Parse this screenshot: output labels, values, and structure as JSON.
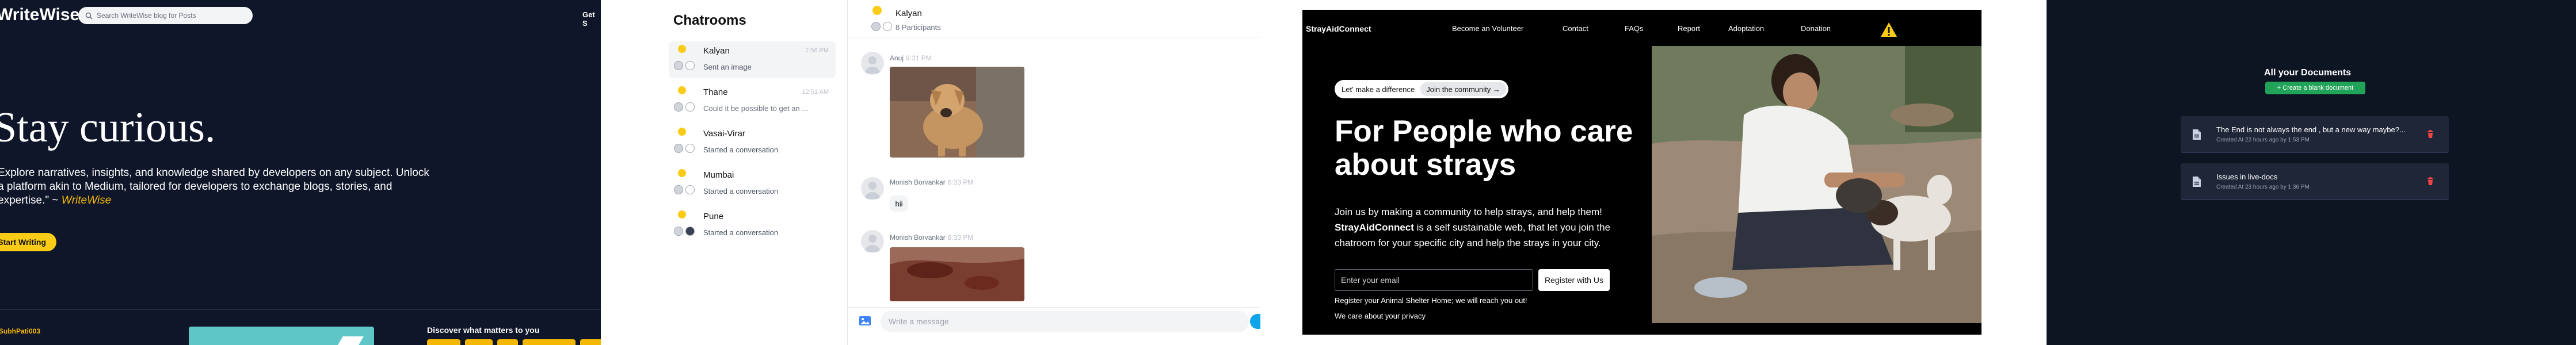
{
  "writewise": {
    "logo": "WriteWise",
    "search_placeholder": "Search WriteWise blog for Posts",
    "get_started": "Get S",
    "hero_title": "Stay curious.",
    "hero_line1": "Explore narratives, insights, and knowledge shared by developers on any subject. Unlock",
    "hero_line2": "a platform akin to Medium, tailored for developers to exchange blogs, stories, and",
    "hero_line3_prefix": "expertise.\" ~ ",
    "hero_brand": "WriteWise",
    "start_writing": "Start Writing",
    "username": "SubhPati003",
    "discover": "Discover what matters to you",
    "colors": {
      "background": "#0f1629",
      "accent": "#facc15"
    }
  },
  "chat": {
    "title": "Chatrooms",
    "rooms": [
      {
        "name": "Kalyan",
        "time": "7:56 PM",
        "preview": "Sent an image",
        "active": true
      },
      {
        "name": "Thane",
        "time": "12:51 AM",
        "preview": "Could it be possible to get an ...",
        "active": false
      },
      {
        "name": "Vasai-Virar",
        "time": "",
        "preview": "Started a conversation",
        "active": false
      },
      {
        "name": "Mumbai",
        "time": "",
        "preview": "Started a conversation",
        "active": false
      },
      {
        "name": "Pune",
        "time": "",
        "preview": "Started a conversation",
        "active": false
      }
    ],
    "header": {
      "name": "Kalyan",
      "participants": "8 Participants"
    },
    "messages": [
      {
        "sender": "Anuj",
        "time": "9:31 PM",
        "type": "image"
      },
      {
        "sender": "Monish Borvankar",
        "time": "6:33 PM",
        "type": "text",
        "text": "hii"
      },
      {
        "sender": "Monish Borvankar",
        "time": "6:33 PM",
        "type": "image"
      }
    ],
    "composer_placeholder": "Write a message"
  },
  "stray": {
    "brand": "StrayAidConnect",
    "nav": [
      "Become an Volunteer",
      "Contact",
      "FAQs",
      "Report",
      "Adoptation",
      "Donation"
    ],
    "badge": "Let' make a difference",
    "badge_link": "Join the community",
    "badge_arrow": "→",
    "headline": "For People who care about strays",
    "para_1": "Join us by making a community to help strays, and help them!",
    "para_brand": "StrayAidConnect",
    "para_2": " is a self sustainable web, that let you join the chatroom for your specific city and help the strays in your city.",
    "email_placeholder": "Enter your email",
    "register": "Register with Us",
    "note_1": "Register your Animal Shelter Home; we will reach you out!",
    "note_2": "We care about your privacy"
  },
  "docs": {
    "title": "All your Documents",
    "create": "+ Create a blank document",
    "items": [
      {
        "title": "The End is not always the end , but a new way maybe?...",
        "meta": "Created At 22 hours ago by 1:53 PM"
      },
      {
        "title": "Issues in live-docs",
        "meta": "Created At 23 hours ago by 1:36 PM"
      }
    ],
    "colors": {
      "create": "#22a35a",
      "delete": "#ef4444"
    }
  }
}
